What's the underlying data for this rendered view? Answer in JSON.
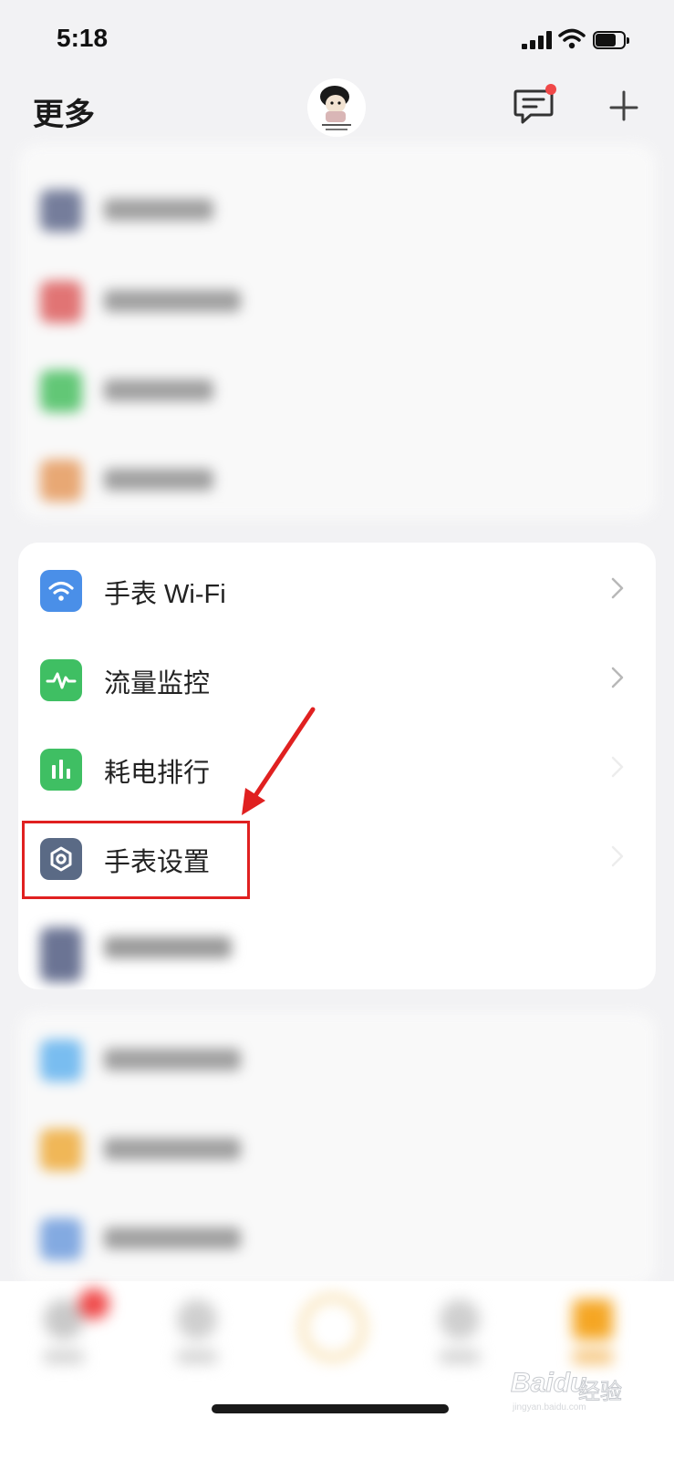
{
  "status_bar": {
    "time": "5:18"
  },
  "header": {
    "title": "更多"
  },
  "visible_items": [
    {
      "label": "手表 Wi-Fi",
      "icon": "wifi-icon",
      "icon_color": "#4a8fe8"
    },
    {
      "label": "流量监控",
      "icon": "pulse-icon",
      "icon_color": "#3fbf63"
    },
    {
      "label": "耗电排行",
      "icon": "bar-chart-icon",
      "icon_color": "#3fbf63"
    },
    {
      "label": "手表设置",
      "icon": "hexagon-settings-icon",
      "icon_color": "#5a6a85"
    }
  ],
  "highlight": {
    "target": "手表设置",
    "color": "#e02020"
  },
  "colors": {
    "accent_badge": "#f04848",
    "tab_active": "#f5a623"
  },
  "watermark": {
    "brand": "Baidu",
    "text": "经验",
    "sub": "jingyan.baidu.com"
  }
}
